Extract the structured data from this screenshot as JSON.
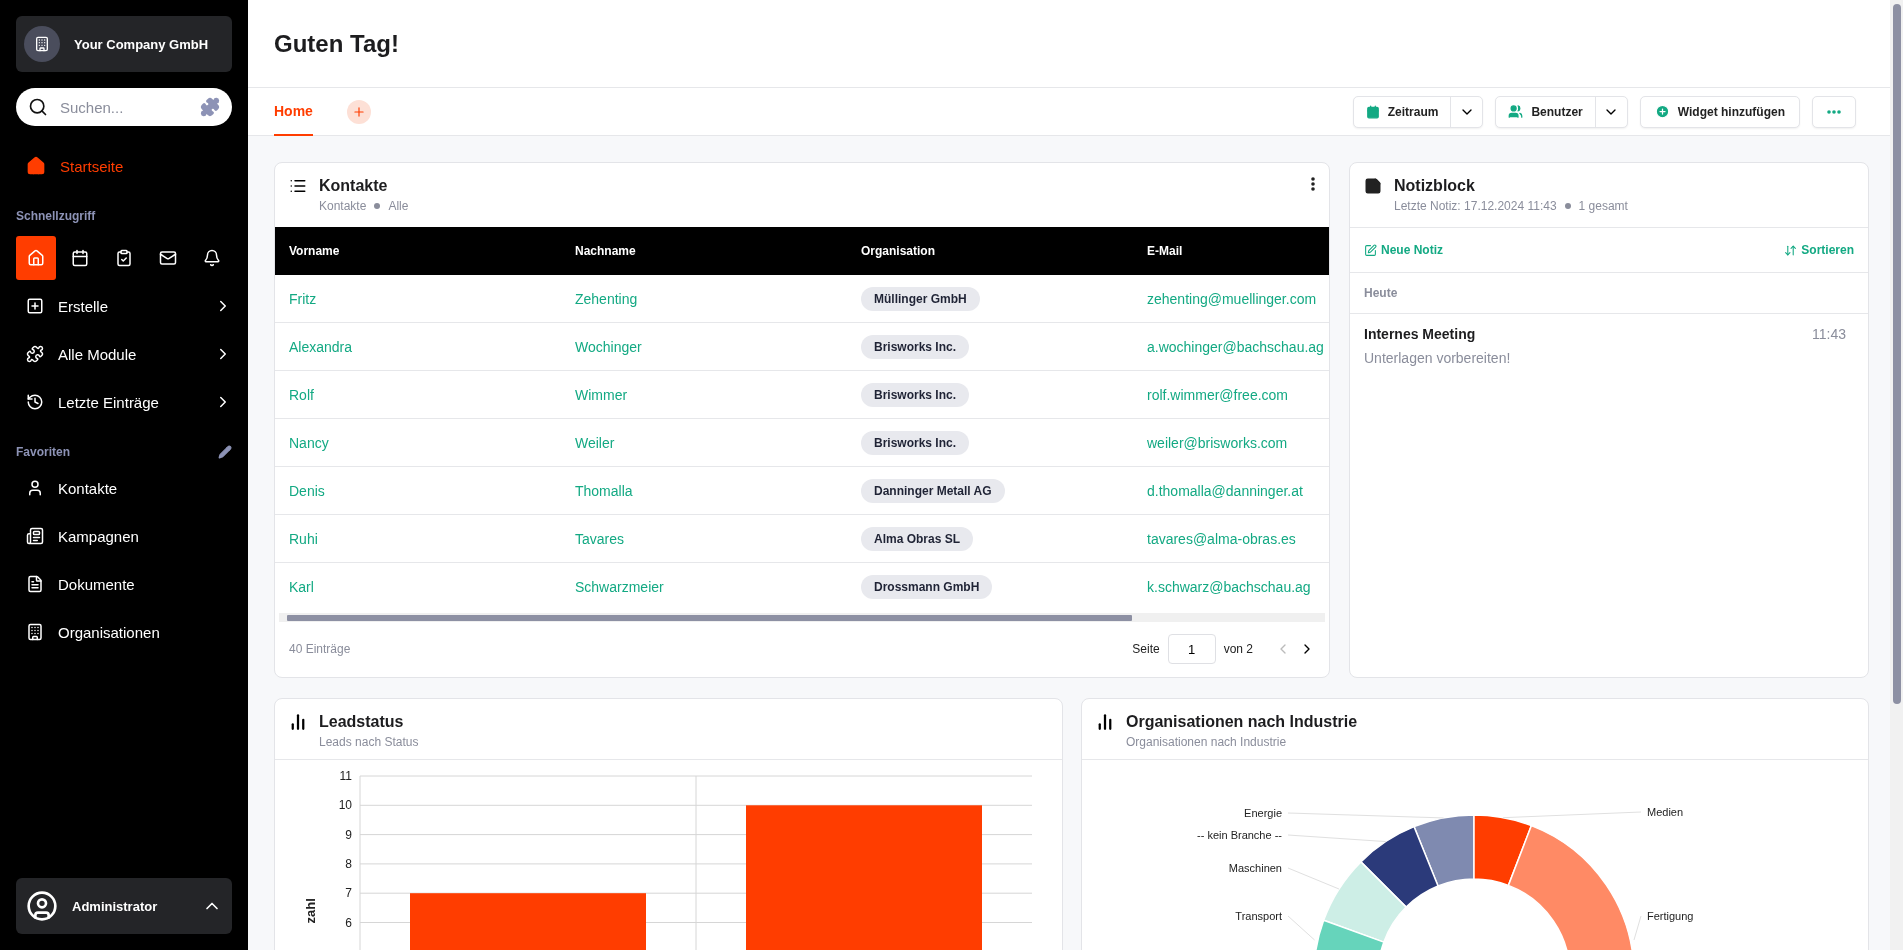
{
  "sidebar": {
    "company": "Your Company GmbH",
    "search": {
      "placeholder": "Suchen..."
    },
    "home": {
      "label": "Startseite",
      "selected": true
    },
    "quick_access": {
      "title": "Schnellzugriff",
      "items": [
        {
          "kind": "home",
          "selected": true
        },
        {
          "kind": "calendar",
          "selected": false
        },
        {
          "kind": "tasks",
          "selected": false
        },
        {
          "kind": "mail",
          "selected": false
        },
        {
          "kind": "bell",
          "selected": false
        }
      ]
    },
    "menu": [
      {
        "kind": "create",
        "label": "Erstelle"
      },
      {
        "kind": "modules",
        "label": "Alle Module"
      },
      {
        "kind": "history",
        "label": "Letzte Einträge"
      }
    ],
    "favorites": {
      "title": "Favoriten",
      "items": [
        {
          "kind": "person",
          "label": "Kontakte"
        },
        {
          "kind": "news",
          "label": "Kampagnen"
        },
        {
          "kind": "document",
          "label": "Dokumente"
        },
        {
          "kind": "building",
          "label": "Organisationen"
        }
      ]
    },
    "user": {
      "name": "Administrator"
    }
  },
  "header": {
    "title": "Guten Tag!"
  },
  "tabs": [
    {
      "label": "Home",
      "selected": true
    }
  ],
  "toolbar": {
    "period": "Zeitraum",
    "users": "Benutzer",
    "add_widget": "Widget hinzufügen"
  },
  "contacts": {
    "title": "Kontakte",
    "subtitle": [
      "Kontakte",
      "Alle"
    ],
    "columns": [
      "Vorname",
      "Nachname",
      "Organisation",
      "E-Mail"
    ],
    "rows": [
      {
        "first": "Fritz",
        "last": "Zehenting",
        "org": "Müllinger GmbH",
        "email": "zehenting@muellinger.com"
      },
      {
        "first": "Alexandra",
        "last": "Wochinger",
        "org": "Brisworks Inc.",
        "email": "a.wochinger@bachschau.ag"
      },
      {
        "first": "Rolf",
        "last": "Wimmer",
        "org": "Brisworks Inc.",
        "email": "rolf.wimmer@free.com"
      },
      {
        "first": "Nancy",
        "last": "Weiler",
        "org": "Brisworks Inc.",
        "email": "weiler@brisworks.com"
      },
      {
        "first": "Denis",
        "last": "Thomalla",
        "org": "Danninger Metall AG",
        "email": "d.thomalla@danninger.at"
      },
      {
        "first": "Ruhi",
        "last": "Tavares",
        "org": "Alma Obras SL",
        "email": "tavares@alma-obras.es"
      },
      {
        "first": "Karl",
        "last": "Schwarzmeier",
        "org": "Drossmann GmbH",
        "email": "k.schwarz@bachschau.ag"
      }
    ],
    "count": "40 Einträge",
    "page_label": "Seite",
    "page": "1",
    "page_total": "von 2"
  },
  "notes": {
    "title": "Notizblock",
    "subtitle": [
      "Letzte Notiz: 17.12.2024 11:43",
      "1 gesamt"
    ],
    "new_note": "Neue Notiz",
    "sort": "Sortieren",
    "group": "Heute",
    "items": [
      {
        "title": "Internes Meeting",
        "time": "11:43",
        "text": "Unterlagen vorbereiten!"
      }
    ]
  },
  "leads": {
    "title": "Leadstatus",
    "subtitle": "Leads nach Status",
    "chart_data": {
      "type": "bar",
      "ylabel": "zahl",
      "values": [
        7,
        10
      ],
      "ylim": [
        0,
        11
      ],
      "yticks": [
        6,
        7,
        8,
        9,
        10,
        11
      ],
      "grid": true
    }
  },
  "industries": {
    "title": "Organisationen nach Industrie",
    "subtitle": "Organisationen nach Industrie",
    "segments": [
      {
        "label": "Energie",
        "color": "#7f8ab0"
      },
      {
        "label": "Medien",
        "color": "#ff3d00"
      },
      {
        "label": "-- kein Branche --",
        "color": "#2b3a7a"
      },
      {
        "label": "Maschinen",
        "color": "#cdeee6"
      },
      {
        "label": "Transport",
        "color": "#66d4bb"
      },
      {
        "label": "Fertigung",
        "color": "#ff8a65"
      }
    ]
  }
}
